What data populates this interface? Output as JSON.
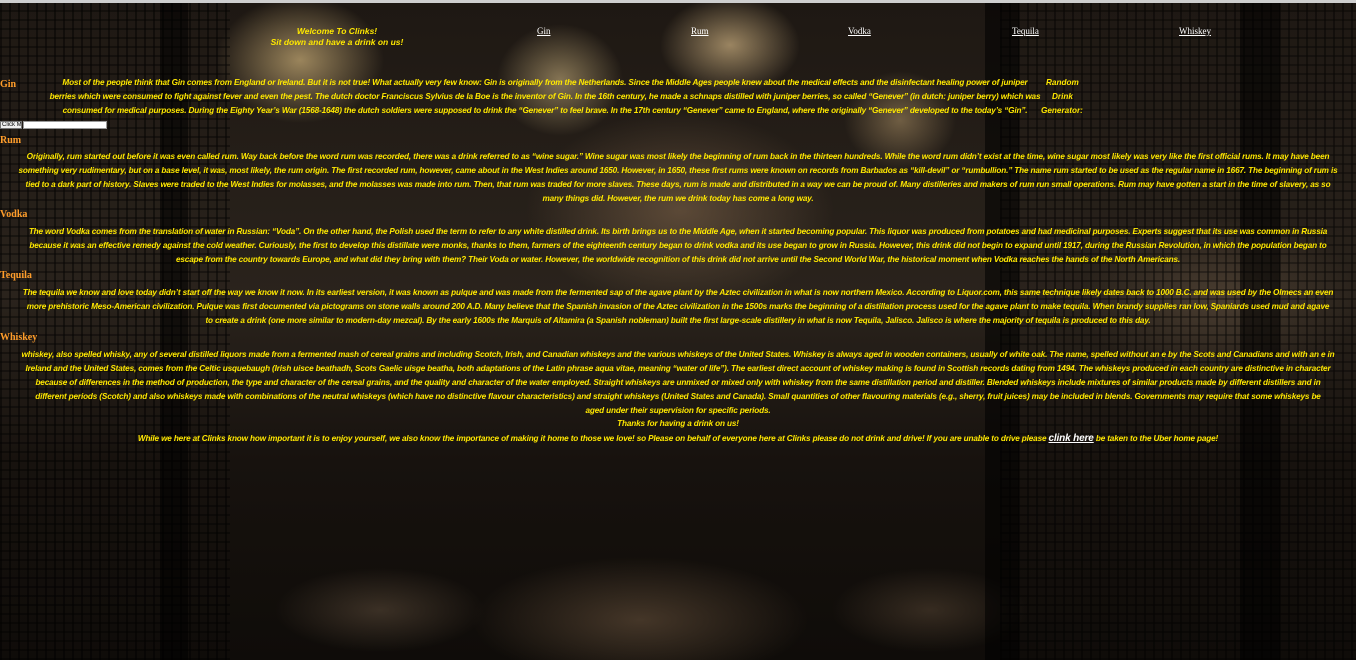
{
  "nav": {
    "welcome_line1": "Welcome To Clinks!",
    "welcome_line2": "Sit down and have a drink on us!",
    "links": [
      "Gin",
      "Rum",
      "Vodka",
      "Tequila",
      "Whiskey"
    ]
  },
  "gin": {
    "heading": "Gin",
    "lines": [
      "Most of the people think that Gin comes from England or Ireland. But it is not true! What actually very few know: Gin is originally from the Netherlands. Since the Middle Ages people knew about the medical effects and the disinfectant healing power of juniper",
      "berries which were consumed to fight against fever and even the pest. The dutch doctor Franciscus Sylvius de la Boe is the inventor of Gin. In the 16th century, he made a schnaps distilled with juniper berries, so called “Genever” (in dutch: juniper berry) which was",
      "consumed for medical purposes. During the Eighty Year’s War (1568-1648) the dutch soldiers were supposed to drink the “Genever” to feel brave. In the 17th century “Genever” came to England, where the originally “Genever” developed to the today’s “Gin”."
    ],
    "generator_line1": "Random",
    "generator_line2": "Drink",
    "generator_line3": "Generator:",
    "button_label": "Click Me",
    "output_value": ""
  },
  "rum": {
    "heading": "Rum",
    "lines": [
      "Originally, rum started out before it was even called rum. Way back before the word rum was recorded, there was a drink referred to as “wine sugar.” Wine sugar was most likely the beginning of rum back in the thirteen hundreds. While the word rum didn’t exist at the time, wine sugar most likely was very like the first official rums. It may have been",
      "something very rudimentary, but on a base level, it was, most likely, the rum origin. The first recorded rum, however, came about in the West Indies around 1650. However, in 1650, these first rums were known on records from Barbados as “kill-devil” or “rumbullion.” The name rum started to be used as the regular name in 1667. The beginning of rum is",
      "tied to a dark part of history. Slaves were traded to the West Indies for molasses, and the molasses was made into rum. Then, that rum was traded for more slaves. These days, rum is made and distributed in a way we can be proud of. Many distilleries and makers of rum run small operations. Rum may have gotten a start in the time of slavery, as so",
      "many things did. However, the rum we drink today has come a long way."
    ]
  },
  "vodka": {
    "heading": "Vodka",
    "lines": [
      "The word Vodka comes from the translation of water in Russian: “Voda”. On the other hand, the Polish used the term to refer to any white distilled drink. Its birth brings us to the Middle Age, when it started becoming popular. This liquor was produced from potatoes and had medicinal purposes. Experts suggest that its use was common in Russia",
      "because it was an effective remedy against the cold weather. Curiously, the first to develop this distillate were monks, thanks to them, farmers of the eighteenth century began to drink vodka and its use began to grow in Russia. However, this drink did not begin to expand until 1917, during the Russian Revolution, in which the population began to",
      "escape from the country towards Europe, and what did they bring with them? Their Voda or water. However, the worldwide recognition of this drink did not arrive until the Second World War, the historical moment when Vodka reaches the hands of the North Americans."
    ]
  },
  "tequila": {
    "heading": "Tequila",
    "lines": [
      "The tequila we know and love today didn’t start off the way we know it now. In its earliest version, it was known as pulque and was made from the fermented sap of the agave plant by the Aztec civilization in what is now northern Mexico. According to Liquor.com, this same technique likely dates back to 1000 B.C. and was used by the Olmecs an even",
      "more prehistoric Meso-American civilization. Pulque was first documented via pictograms on stone walls around 200 A.D. Many believe that the Spanish invasion of the Aztec civilization in the 1500s marks the beginning of a distillation process used for the agave plant to make tequila. When brandy supplies ran low, Spaniards used mud and agave",
      "to create a drink (one more similar to modern-day mezcal). By the early 1600s the Marquis of Altamira (a Spanish nobleman) built the first large-scale distillery in what is now Tequila, Jalisco. Jalisco is where the majority of tequila is produced to this day."
    ]
  },
  "whiskey": {
    "heading": "Whiskey",
    "lines": [
      "whiskey, also spelled whisky, any of several distilled liquors made from a fermented mash of cereal grains and including Scotch, Irish, and Canadian whiskeys and the various whiskeys of the United States. Whiskey is always aged in wooden containers, usually of white oak. The name, spelled without an e by the Scots and Canadians and with an e in",
      "Ireland and the United States, comes from the Celtic usquebaugh (Irish uisce beathadh, Scots Gaelic uisge beatha, both adaptations of the Latin phrase aqua vitae, meaning “water of life”). The earliest direct account of whiskey making is found in Scottish records dating from 1494. The whiskeys produced in each country are distinctive in character",
      "because of differences in the method of production, the type and character of the cereal grains, and the quality and character of the water employed. Straight whiskeys are unmixed or mixed only with whiskey from the same distillation period and distiller. Blended whiskeys include mixtures of similar products made by different distillers and in",
      "different periods (Scotch) and also whiskeys made with combinations of the neutral whiskeys (which have no distinctive flavour characteristics) and straight whiskeys (United States and Canada). Small quantities of other flavouring materials (e.g., sherry, fruit juices) may be included in blends. Governments may require that some whiskeys be",
      "aged under their supervision for specific periods."
    ]
  },
  "footer": {
    "thanks": "Thanks for having a drink on us!",
    "drive_before": "While we here at Clinks know how important it is to enjoy yourself, we also know the importance of making it home to those we love! so Please on behalf of everyone here at Clinks please do not drink and drive! If you are unable to drive please",
    "drive_link": "clink here",
    "drive_after": "be taken to the Uber home page!"
  },
  "colors": {
    "text": "#ffe800",
    "heading": "#ff9d2a",
    "link": "#ffffff"
  }
}
